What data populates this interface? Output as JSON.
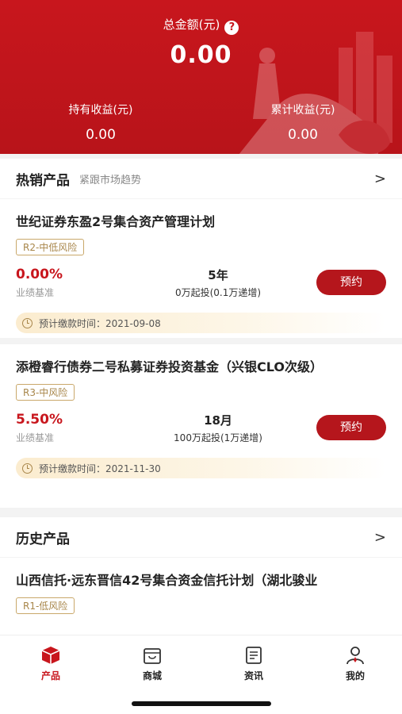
{
  "header": {
    "total_label": "总金额(元)",
    "help_glyph": "?",
    "total_value": "0.00",
    "holding_label": "持有收益(元)",
    "holding_value": "0.00",
    "cumulative_label": "累计收益(元)",
    "cumulative_value": "0.00"
  },
  "hot": {
    "title": "热销产品",
    "subtitle": "紧跟市场趋势",
    "chevron": ">"
  },
  "products": [
    {
      "name": "世纪证券东盈2号集合资产管理计划",
      "risk": "R2-中低风险",
      "rate": "0.00%",
      "rate_label": "业绩基准",
      "term": "5年",
      "start": "0万起投(0.1万递增)",
      "button": "预约",
      "pay_time": "预计缴款时间：2021-09-08"
    },
    {
      "name": "添橙睿行债券二号私募证券投资基金（兴银CLO次级）",
      "risk": "R3-中风险",
      "rate": "5.50%",
      "rate_label": "业绩基准",
      "term": "18月",
      "start": "100万起投(1万递增)",
      "button": "预约",
      "pay_time": "预计缴款时间：2021-11-30"
    }
  ],
  "history": {
    "title": "历史产品",
    "chevron": ">",
    "item": {
      "name": "山西信托·远东晋信42号集合资金信托计划（湖北骏业",
      "risk": "R1-低风险"
    }
  },
  "tabbar": [
    {
      "label": "产品",
      "icon": "product-box-icon",
      "active": true
    },
    {
      "label": "商城",
      "icon": "shop-bag-icon",
      "active": false
    },
    {
      "label": "资讯",
      "icon": "news-doc-icon",
      "active": false
    },
    {
      "label": "我的",
      "icon": "profile-user-icon",
      "active": false
    }
  ],
  "colors": {
    "brand_red": "#c8161d",
    "gold": "#a8864a"
  }
}
